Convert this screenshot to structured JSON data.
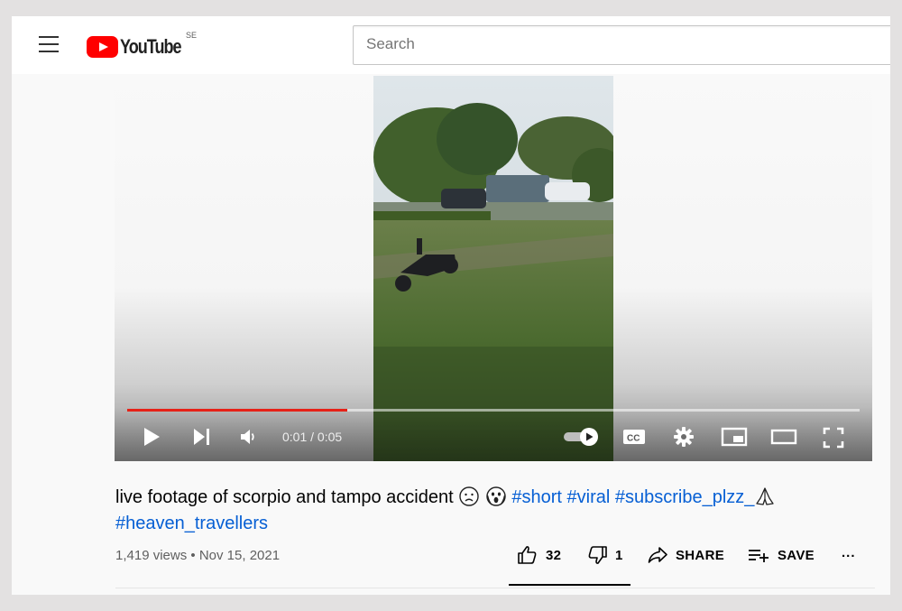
{
  "header": {
    "logo_text": "YouTube",
    "country_code": "SE",
    "search_placeholder": "Search"
  },
  "player": {
    "current_time": "0:01",
    "duration": "0:05",
    "time_display": "0:01 / 0:05",
    "progress_fraction": 0.3,
    "icons": [
      "play-icon",
      "next-icon",
      "volume-icon",
      "autoplay-toggle-icon",
      "subtitles-icon",
      "settings-icon",
      "miniplayer-icon",
      "theater-mode-icon",
      "fullscreen-icon"
    ]
  },
  "video": {
    "title_text": "live footage of scorpio and tampo accident",
    "hashtags": [
      "#short",
      "#viral",
      "#subscribe_plzz_"
    ],
    "hashtag_line2": "#heaven_travellers",
    "views": "1,419 views",
    "separator": "•",
    "date": "Nov 15, 2021"
  },
  "actions": {
    "like_count": "32",
    "dislike_count": "1",
    "share_label": "SHARE",
    "save_label": "SAVE",
    "more_label": "..."
  },
  "colors": {
    "accent_red": "#ff0000",
    "progress_red": "#e62117",
    "link_blue": "#065fd4"
  }
}
